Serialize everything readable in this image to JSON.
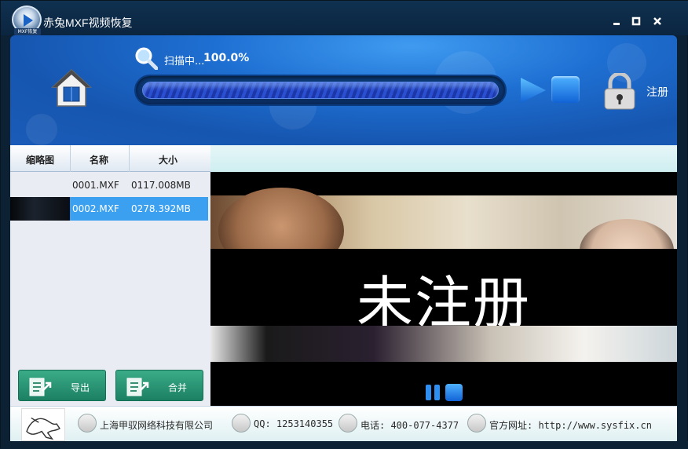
{
  "window": {
    "title": "赤兔MXF视频恢复",
    "logo_tag": "MXF恢复",
    "min_icon": "minimize-icon",
    "max_icon": "maximize-icon",
    "close_icon": "close-icon"
  },
  "toolbar": {
    "scan_label": "扫描中...",
    "scan_percent": "100.0%",
    "progress_fraction": 1.0,
    "register_label": "注册",
    "accent": "#1e6fd2"
  },
  "file_list": {
    "columns": [
      "缩略图",
      "名称",
      "大小"
    ],
    "rows": [
      {
        "name": "0001.MXF",
        "size": "0117.008MB",
        "selected": false
      },
      {
        "name": "0002.MXF",
        "size": "0278.392MB",
        "selected": true
      }
    ],
    "export_label": "导出",
    "merge_label": "合并"
  },
  "preview": {
    "watermark": "未注册"
  },
  "footer": {
    "company": "上海甲驭网络科技有限公司",
    "qq": "QQ: 1253140355",
    "phone": "电话: 400-077-4377",
    "website": "官方网址: http://www.sysfix.cn"
  }
}
